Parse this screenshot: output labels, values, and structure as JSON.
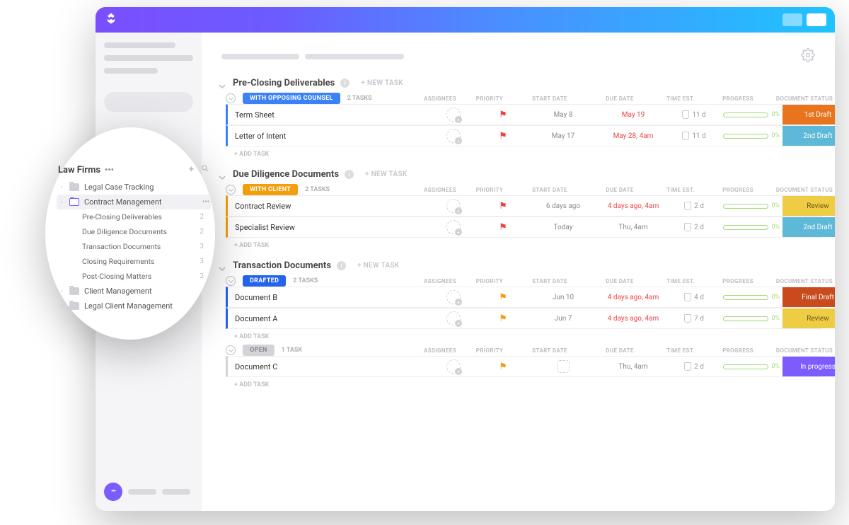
{
  "sidebar_popup": {
    "title": "Law Firms",
    "items": [
      {
        "label": "Legal Case Tracking"
      },
      {
        "label": "Contract Management",
        "active": true
      },
      {
        "label": "Client Management"
      },
      {
        "label": "Legal Client Management"
      }
    ],
    "sub_items": [
      {
        "label": "Pre-Closing Deliverables",
        "count": "2"
      },
      {
        "label": "Due Diligence Documents",
        "count": "2"
      },
      {
        "label": "Transaction Documents",
        "count": "3"
      },
      {
        "label": "Closing Requirements",
        "count": "3"
      },
      {
        "label": "Post-Closing Matters",
        "count": "2"
      }
    ]
  },
  "new_task_label": "+ NEW TASK",
  "add_task_label": "+ ADD TASK",
  "columns": {
    "assignees": "ASSIGNEES",
    "priority": "PRIORITY",
    "start_date": "START DATE",
    "due_date": "DUE DATE",
    "time_est": "TIME EST.",
    "progress": "PROGRESS",
    "document_status": "DOCUMENT STATUS"
  },
  "sections": [
    {
      "title": "Pre-Closing Deliverables",
      "groups": [
        {
          "status_label": "WITH OPPOSING COUNSEL",
          "status_class": "with-opposing",
          "border": "border-blue",
          "task_count": "2 TASKS",
          "tasks": [
            {
              "name": "Term Sheet",
              "flag": "red",
              "start": "May 8",
              "due": "May 19",
              "due_red": true,
              "time": "11 d",
              "doc": "1st Draft",
              "doc_class": "first-draft"
            },
            {
              "name": "Letter of Intent",
              "flag": "red",
              "start": "May 17",
              "due": "May 28, 4am",
              "due_red": true,
              "time": "11 d",
              "doc": "2nd Draft",
              "doc_class": "second-draft"
            }
          ]
        }
      ]
    },
    {
      "title": "Due Diligence Documents",
      "groups": [
        {
          "status_label": "WITH CLIENT",
          "status_class": "with-client",
          "border": "border-orange",
          "task_count": "2 TASKS",
          "tasks": [
            {
              "name": "Contract Review",
              "flag": "red",
              "start": "6 days ago",
              "due": "4 days ago, 4am",
              "due_red": true,
              "time": "2 d",
              "doc": "Review",
              "doc_class": "review"
            },
            {
              "name": "Specialist Review",
              "flag": "red",
              "start": "Today",
              "due": "Thu, 4am",
              "time": "2 d",
              "doc": "2nd Draft",
              "doc_class": "second-draft"
            }
          ]
        }
      ]
    },
    {
      "title": "Transaction Documents",
      "groups": [
        {
          "status_label": "DRAFTED",
          "status_class": "drafted",
          "border": "border-drafted",
          "task_count": "2 TASKS",
          "tasks": [
            {
              "name": "Document B",
              "flag": "yellow",
              "start": "Jun 10",
              "due": "4 days ago, 4am",
              "due_red": true,
              "time": "4 d",
              "doc": "Final Draft",
              "doc_class": "final-draft"
            },
            {
              "name": "Document A",
              "flag": "yellow",
              "start": "Jun 7",
              "due": "4 days ago, 4am",
              "due_red": true,
              "time": "7 d",
              "doc": "Review",
              "doc_class": "review"
            }
          ]
        },
        {
          "status_label": "OPEN",
          "status_class": "open",
          "border": "border-open",
          "task_count": "1 TASK",
          "tasks": [
            {
              "name": "Document C",
              "flag": "yellow",
              "start_icon": true,
              "due": "Thu, 4am",
              "time": "2 d",
              "doc": "In progress",
              "doc_class": "in-progress"
            }
          ]
        }
      ]
    }
  ],
  "progress_pct": "0%"
}
